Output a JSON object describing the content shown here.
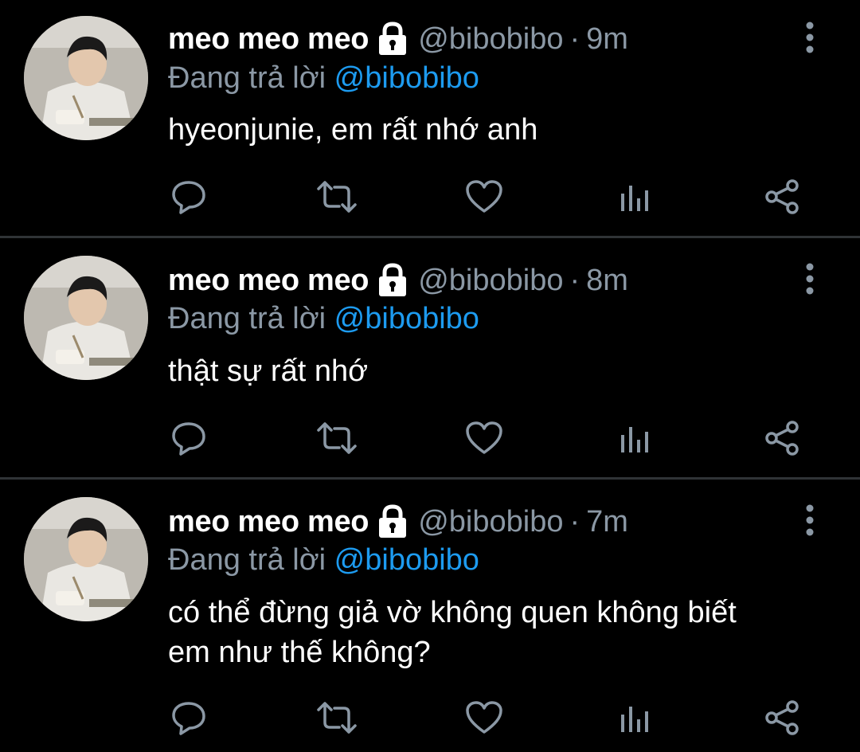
{
  "tweets": [
    {
      "name": "meo meo meo",
      "handle": "@bibobibo",
      "separator": "·",
      "time": "9m",
      "reply_prefix": "Đang trả lời",
      "reply_to": "@bibobibo",
      "text": "hyeonjunie, em rất nhớ anh"
    },
    {
      "name": "meo meo meo",
      "handle": "@bibobibo",
      "separator": "·",
      "time": "8m",
      "reply_prefix": "Đang trả lời",
      "reply_to": "@bibobibo",
      "text": "thật sự rất nhớ"
    },
    {
      "name": "meo meo meo",
      "handle": "@bibobibo",
      "separator": "·",
      "time": "7m",
      "reply_prefix": "Đang trả lời",
      "reply_to": "@bibobibo",
      "text_lines": [
        "có thể đừng giả vờ không quen không biết",
        "em như thế không?"
      ]
    }
  ],
  "icons": {
    "lock": "lock-icon",
    "more": "more-vertical-icon",
    "reply": "reply-icon",
    "retweet": "retweet-icon",
    "like": "heart-icon",
    "analytics": "analytics-icon",
    "share": "share-icon"
  },
  "colors": {
    "background": "#000000",
    "primary_text": "#ffffff",
    "secondary_text": "#8b98a5",
    "mention": "#1d9bf0",
    "divider": "#2f3336"
  }
}
